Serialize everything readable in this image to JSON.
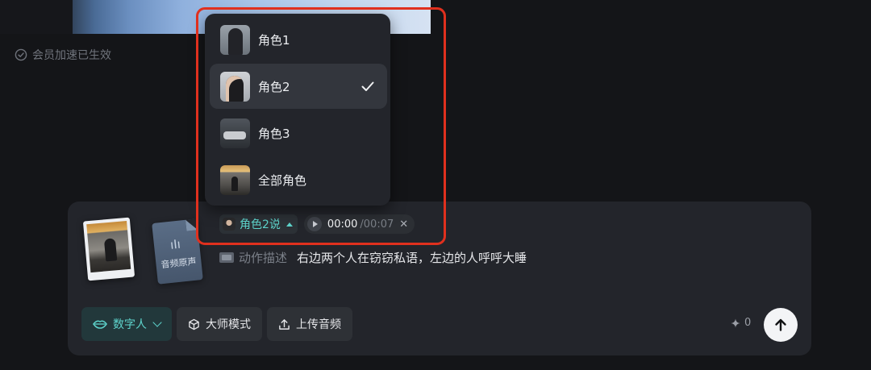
{
  "status": {
    "acceleration_text": "会员加速已生效"
  },
  "dropdown": {
    "options": [
      {
        "label": "角色1",
        "icon": "role1-avatar",
        "selected": false
      },
      {
        "label": "角色2",
        "icon": "role2-avatar",
        "selected": true
      },
      {
        "label": "角色3",
        "icon": "role3-avatar",
        "selected": false
      },
      {
        "label": "全部角色",
        "icon": "all-roles-avatar",
        "selected": false
      }
    ]
  },
  "speaker": {
    "label": "角色2说"
  },
  "audio": {
    "current_time": "00:00",
    "total_time": "/00:07"
  },
  "attachments": {
    "audio_card_label": "音频原声"
  },
  "description": {
    "tag": "动作描述",
    "text": "右边两个人在窃窃私语，左边的人呼呼大睡"
  },
  "toolbar": {
    "digital_human_label": "数字人",
    "master_mode_label": "大师模式",
    "upload_audio_label": "上传音频"
  },
  "credits": {
    "value": "0"
  },
  "colors": {
    "accent": "#5ed4cc",
    "highlight": "#e0301e",
    "background": "#141518",
    "panel": "#23252b"
  }
}
